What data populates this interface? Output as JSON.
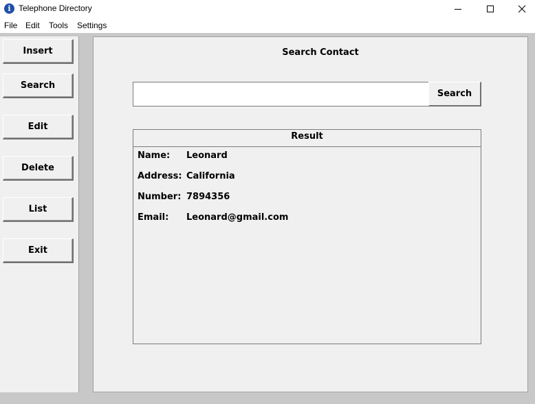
{
  "window": {
    "title": "Telephone Directory",
    "icon": "info-icon"
  },
  "menu": [
    "File",
    "Edit",
    "Tools",
    "Settings"
  ],
  "sidebar": {
    "buttons": [
      "Insert",
      "Search",
      "Edit",
      "Delete",
      "List",
      "Exit"
    ]
  },
  "main": {
    "title": "Search Contact",
    "search_value": "",
    "search_button": "Search",
    "result_header": "Result",
    "fields": [
      {
        "label": "Name:",
        "value": "Leonard"
      },
      {
        "label": "Address:",
        "value": "California"
      },
      {
        "label": "Number:",
        "value": "7894356"
      },
      {
        "label": "Email:",
        "value": "Leonard@gmail.com"
      }
    ]
  },
  "colors": {
    "panel_bg": "#f0f0f0",
    "desktop_bg": "#c8c8c8",
    "titlebar_bg": "#ffffff",
    "icon_blue": "#1f4fa8"
  }
}
